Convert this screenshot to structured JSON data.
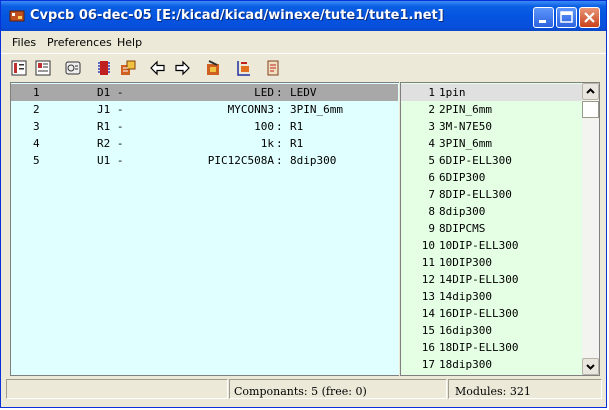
{
  "window": {
    "title": "Cvpcb 06-dec-05 [E:/kicad/kicad/winexe/tute1/tute1.net]"
  },
  "menu": {
    "items": [
      "Files",
      "Preferences",
      "Help"
    ]
  },
  "components": [
    {
      "num": "1",
      "ref": "D1 -",
      "value": "LED",
      "footprint": "LEDV",
      "selected": true
    },
    {
      "num": "2",
      "ref": "J1 -",
      "value": "MYCONN3",
      "footprint": "3PIN_6mm"
    },
    {
      "num": "3",
      "ref": "R1 -",
      "value": "100",
      "footprint": "R1"
    },
    {
      "num": "4",
      "ref": "R2 -",
      "value": "1k",
      "footprint": "R1"
    },
    {
      "num": "5",
      "ref": "U1 -",
      "value": "PIC12C508A",
      "footprint": "8dip300"
    }
  ],
  "modules": [
    {
      "num": "1",
      "name": "1pin",
      "selected": true
    },
    {
      "num": "2",
      "name": "2PIN_6mm"
    },
    {
      "num": "3",
      "name": "3M-N7E50"
    },
    {
      "num": "4",
      "name": "3PIN_6mm"
    },
    {
      "num": "5",
      "name": "6DIP-ELL300"
    },
    {
      "num": "6",
      "name": "6DIP300"
    },
    {
      "num": "7",
      "name": "8DIP-ELL300"
    },
    {
      "num": "8",
      "name": "8dip300"
    },
    {
      "num": "9",
      "name": "8DIPCMS"
    },
    {
      "num": "10",
      "name": "10DIP-ELL300"
    },
    {
      "num": "11",
      "name": "10DIP300"
    },
    {
      "num": "12",
      "name": "14DIP-ELL300"
    },
    {
      "num": "13",
      "name": "14dip300"
    },
    {
      "num": "14",
      "name": "16DIP-ELL300"
    },
    {
      "num": "15",
      "name": "16dip300"
    },
    {
      "num": "16",
      "name": "18DIP-ELL300"
    },
    {
      "num": "17",
      "name": "18dip300"
    }
  ],
  "status": {
    "components": "Componants: 5 (free: 0)",
    "modules": "Modules: 321"
  },
  "toolbar": {
    "icons": [
      "netlist-icon",
      "save-icon",
      "library-icon",
      "module-icon",
      "auto-assoc-icon",
      "prev-arrow-icon",
      "next-arrow-icon",
      "delete-assoc-icon",
      "filter-icon",
      "doc-icon"
    ]
  },
  "colors": {
    "title_bar": "#0554e0",
    "component_bg": "#e0ffff",
    "module_bg": "#e4ffe4",
    "selected_row": "#a8a8a8"
  }
}
